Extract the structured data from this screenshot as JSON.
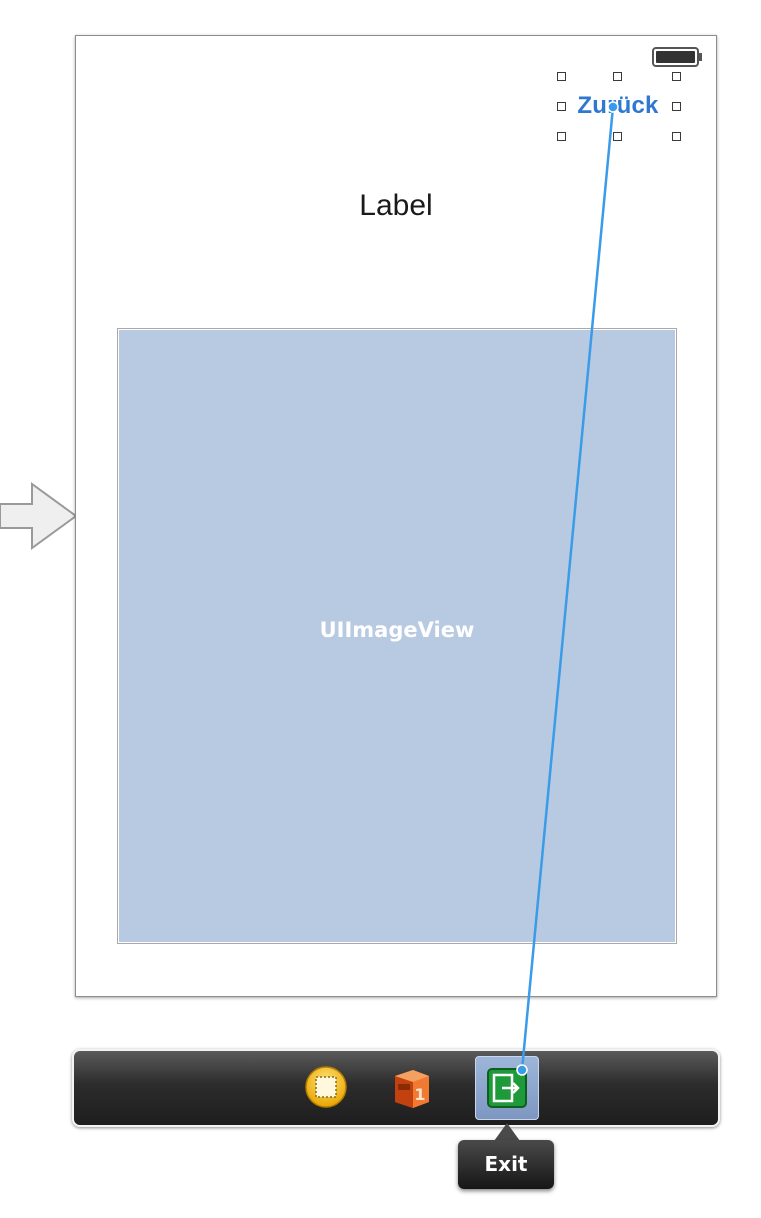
{
  "scene": {
    "back_button_label": "Zurück",
    "label_text": "Label",
    "image_view_label": "UIImageView"
  },
  "dock": {
    "icons": [
      "first-responder-icon",
      "view-controller-icon",
      "exit-icon"
    ],
    "tooltip": "Exit"
  },
  "colors": {
    "accent_blue": "#2e78d2",
    "image_view_fill": "#b8cae2",
    "connection_line": "#3a9be8",
    "exit_icon_green": "#1e9a3a",
    "dock_dark": "#2c2c2c"
  }
}
